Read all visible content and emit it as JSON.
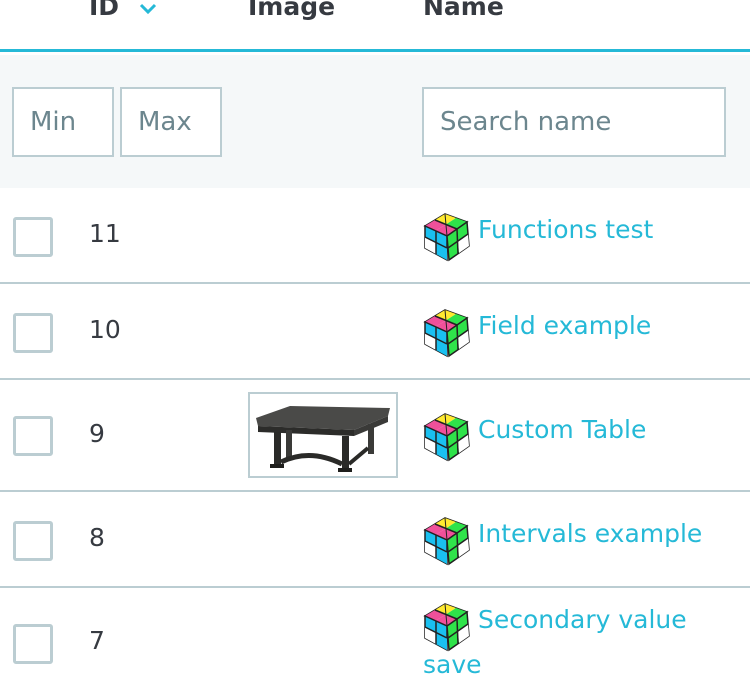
{
  "header": {
    "id_label": "ID",
    "image_label": "Image",
    "name_label": "Name"
  },
  "filters": {
    "min_placeholder": "Min",
    "max_placeholder": "Max",
    "name_placeholder": "Search name"
  },
  "rows": [
    {
      "id": "11",
      "name": "Functions test",
      "has_image": false
    },
    {
      "id": "10",
      "name": "Field example",
      "has_image": false
    },
    {
      "id": "9",
      "name": "Custom Table",
      "has_image": true
    },
    {
      "id": "8",
      "name": "Intervals example",
      "has_image": false
    },
    {
      "id": "7",
      "name": "Secondary value",
      "name_line2": "save",
      "has_image": false
    }
  ],
  "colors": {
    "accent": "#25b9d7",
    "border": "#bbcdd2",
    "filter_bg": "#f5f8f9",
    "text": "#363a41"
  }
}
